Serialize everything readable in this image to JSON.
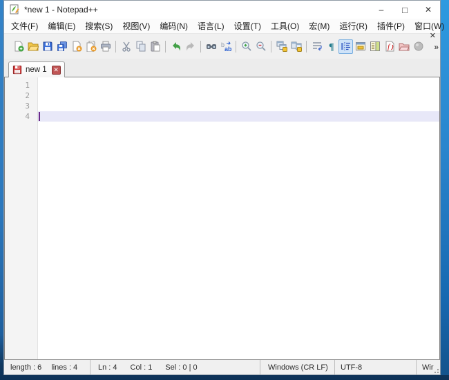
{
  "window": {
    "title": "*new 1 - Notepad++",
    "minimize_label": "–",
    "maximize_label": "□",
    "close_label": "✕"
  },
  "menu_bar": {
    "items": [
      "文件(F)",
      "编辑(E)",
      "搜索(S)",
      "视图(V)",
      "编码(N)",
      "语言(L)",
      "设置(T)",
      "工具(O)",
      "宏(M)",
      "运行(R)",
      "插件(P)",
      "窗口(W)",
      "?"
    ],
    "close_document_label": "✕"
  },
  "toolbar": {
    "overflow_label": "»",
    "icons": [
      "new-file",
      "open-file",
      "save",
      "save-all",
      "close-file",
      "close-all",
      "print",
      "cut",
      "copy",
      "paste",
      "undo",
      "redo",
      "find",
      "replace",
      "zoom-in",
      "zoom-out",
      "sync-vertical-scroll",
      "sync-horizontal-scroll",
      "word-wrap",
      "show-all-characters",
      "show-indent-guide",
      "user-defined-dialog",
      "document-map",
      "function-list",
      "folder-as-workspace",
      "record-macro"
    ],
    "active_icon": "show-indent-guide"
  },
  "tab_bar": {
    "tabs": [
      {
        "label": "new 1",
        "modified": true,
        "close_label": "✕"
      }
    ]
  },
  "editor": {
    "line_numbers": [
      "1",
      "2",
      "3",
      "4"
    ],
    "text": "",
    "cursor_line": 4,
    "cursor_col": 1
  },
  "status_bar": {
    "length_label": "length : 6",
    "lines_label": "lines : 4",
    "ln_label": "Ln : 4",
    "col_label": "Col : 1",
    "sel_label": "Sel : 0 | 0",
    "eol_label": "Windows (CR LF)",
    "encoding_label": "UTF-8",
    "mode_label": "Wir"
  },
  "colors": {
    "desktop_blue": "#2e7fc4",
    "current_line_highlight": "#e8e8f8",
    "active_tool_highlight": "#cfe3f8",
    "modified_tab_red": "#d23f3f"
  }
}
